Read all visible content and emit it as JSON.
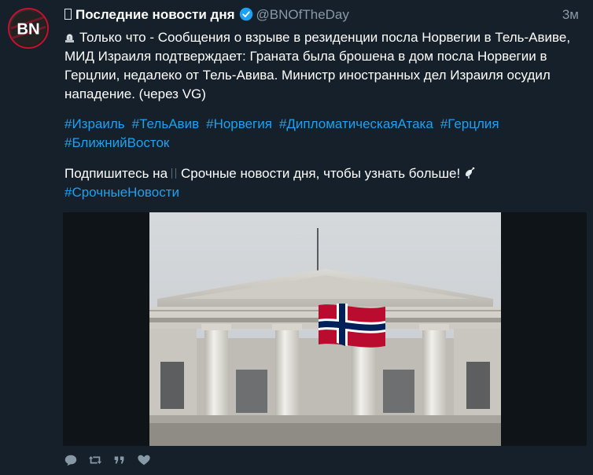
{
  "tweet": {
    "author_name": "Последние новости дня",
    "handle": "@BNOfTheDay",
    "time": "3м",
    "text": "Только что - Сообщения о взрыве в резиденции посла Норвегии в Тель-Авиве, МИД Израиля подтверждает: Граната была брошена в дом посла Норвегии в Герцлии, недалеко от Тель-Авива. Министр иностранных дел Израиля осудил нападение. (через VG)",
    "hashtags": [
      "#Израиль",
      "#ТельАвив",
      "#Норвегия",
      "#ДипломатическаяАтака",
      "#Герцлия",
      "#БлижнийВосток"
    ],
    "subscribe_before": "Подпишитесь на",
    "subscribe_after": "Срочные новости дня, чтобы узнать больше!",
    "subscribe_hashtag": "#СрочныеНовости",
    "avatar_text": "BN",
    "icons": {
      "author_prefix": "box-glyph-icon",
      "verified": "verified-badge-icon",
      "siren": "police-light-icon",
      "satellite": "satellite-dish-icon"
    },
    "media": {
      "description_icon": "photo-building-with-norwegian-flag"
    }
  },
  "actions": {
    "reply": "reply-icon",
    "retweet": "retweet-icon",
    "quote": "quote-icon",
    "like": "like-icon"
  },
  "colors": {
    "background": "#15202b",
    "text": "#ffffff",
    "secondary": "#8899a6",
    "link": "#1da1f2",
    "brand_red": "#c8102e"
  }
}
